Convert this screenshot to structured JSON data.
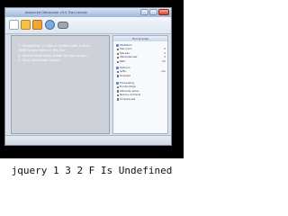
{
  "window": {
    "title": "Javascript Obfuscator v3.0 Trial License"
  },
  "editor": {
    "drop_hint": "1. Drag&drop .js files or folders with js files HERE to get them in the list.\n2. Select destination folder for the scripts.\n3. Click Obfuscate button"
  },
  "panel": {
    "header": "Tool License",
    "statistics": {
      "title": "Statistics",
      "rows": [
        {
          "label": "Files count:",
          "value": "0"
        },
        {
          "label": "Files size:",
          "value": "0"
        },
        {
          "label": "Obfuscated size:",
          "value": "0"
        },
        {
          "label": "Ratio:",
          "value": "0%"
        }
      ]
    },
    "options": {
      "title": "Options",
      "rows": [
        {
          "label": "Suffix:",
          "value": ".min"
        },
        {
          "label": "Compress",
          "value": ""
        }
      ]
    },
    "processing": {
      "title": "Processing",
      "rows": [
        {
          "label": "Encode strings",
          "value": ""
        },
        {
          "label": "Obfuscate names",
          "value": ""
        },
        {
          "label": "Remove comments",
          "value": ""
        },
        {
          "label": "Compress size",
          "value": ""
        }
      ]
    }
  },
  "caption": "jquery 1 3 2 F Is Undefined"
}
